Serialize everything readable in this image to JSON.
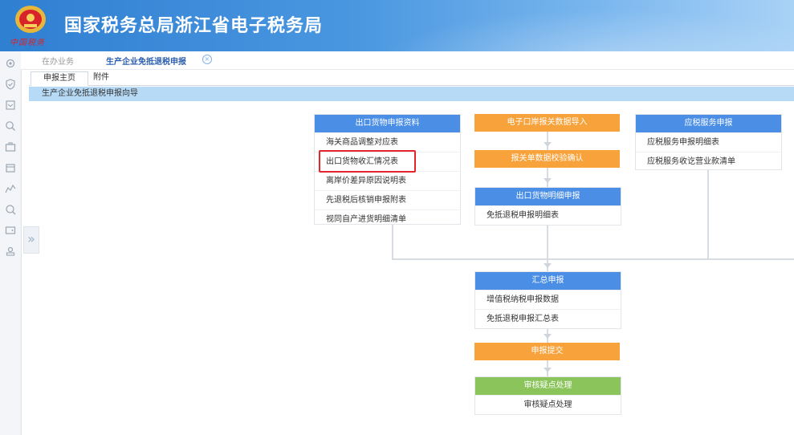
{
  "header": {
    "title": "国家税务总局浙江省电子税务局",
    "emblem_text": "中国税务"
  },
  "breadcrumb": {
    "item1": "在办业务",
    "item2": "生产企业免抵退税申报"
  },
  "tabs": [
    {
      "label": "申报主页"
    },
    {
      "label": "附件"
    }
  ],
  "guide": {
    "title": "生产企业免抵退税申报向导"
  },
  "col1": {
    "title": "出口货物申报资料",
    "items": [
      {
        "label": "海关商品调整对应表"
      },
      {
        "label": "出口货物收汇情况表"
      },
      {
        "label": "离岸价差异原因说明表"
      },
      {
        "label": "先退税后核销申报附表"
      },
      {
        "label": "视同自产进货明细清单"
      }
    ]
  },
  "col2": {
    "step1": "电子口岸报关数据导入",
    "step2": "报关单数据校验确认",
    "step3": {
      "title": "出口货物明细申报",
      "items": [
        {
          "label": "免抵退税申报明细表"
        }
      ]
    },
    "step4": {
      "title": "汇总申报",
      "items": [
        {
          "label": "增值税纳税申报数据"
        },
        {
          "label": "免抵退税申报汇总表"
        }
      ]
    },
    "step5": "申报提交",
    "step6": {
      "title": "审核疑点处理",
      "items": [
        {
          "label": "审核疑点处理"
        }
      ]
    }
  },
  "col3": {
    "title": "应税服务申报",
    "items": [
      {
        "label": "应税服务申报明细表"
      },
      {
        "label": "应税服务收讫营业款清单"
      }
    ]
  },
  "colors": {
    "panel_blue": "#4a8ee6",
    "step_orange": "#f7a23b",
    "step_green": "#8ac45a",
    "highlight_red": "#e2262c"
  }
}
